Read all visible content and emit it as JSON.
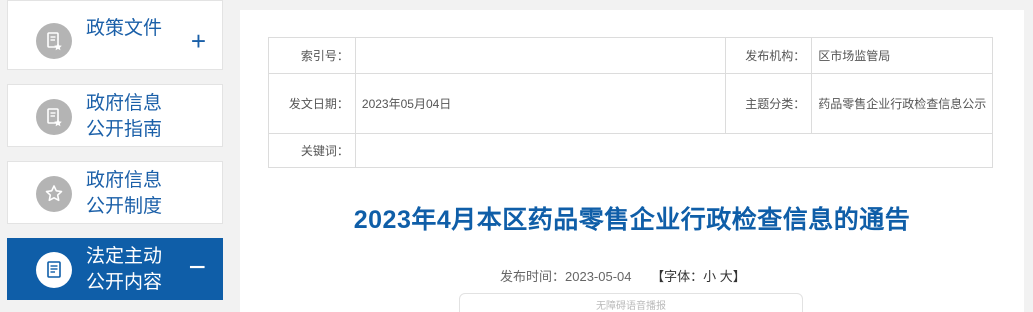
{
  "sidebar": {
    "items": [
      {
        "label": "政策文件",
        "icon": "document-star-icon",
        "toggle": "+"
      },
      {
        "label": "政府信息\n公开指南",
        "icon": "document-star-icon"
      },
      {
        "label": "政府信息\n公开制度",
        "icon": "star-badge-icon"
      },
      {
        "label": "法定主动\n公开内容",
        "icon": "document-list-icon",
        "toggle": "−"
      }
    ]
  },
  "meta": {
    "index_label": "索引号：",
    "index_value": "",
    "publisher_label": "发布机构：",
    "publisher_value": "区市场监管局",
    "date_label": "发文日期：",
    "date_value": "2023年05月04日",
    "category_label": "主题分类：",
    "category_value": "药品零售企业行政检查信息公示",
    "keyword_label": "关键词：",
    "keyword_value": ""
  },
  "article": {
    "title": "2023年4月本区药品零售企业行政检查信息的通告",
    "publish_time": "发布时间：2023-05-04",
    "font_label": "【字体：",
    "font_small": "小",
    "font_large": "大",
    "font_close": "】",
    "tts_notice": "无障碍语音播报"
  },
  "colors": {
    "accent": "#0f5ea8",
    "icon_gray": "#b4b4b4",
    "background": "#f2f2f2"
  }
}
